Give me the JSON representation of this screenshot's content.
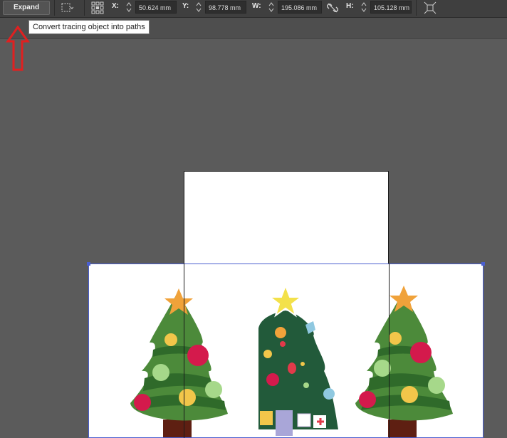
{
  "toolbar": {
    "expand_label": "Expand",
    "x_label": "X:",
    "x_value": "50.624 mm",
    "y_label": "Y:",
    "y_value": "98.778 mm",
    "w_label": "W:",
    "w_value": "195.086 mm",
    "h_label": "H:",
    "h_value": "105.128 mm"
  },
  "tooltip": {
    "text": "Convert tracing object into paths"
  },
  "icons": {
    "selection": "marquee-selection-icon",
    "transform": "reference-point-icon",
    "link": "constrain-proportions-link-icon",
    "transform_panel": "transform-panel-icon",
    "annotation": "red-up-arrow-annotation"
  },
  "colors": {
    "annotation_red": "#e02020",
    "selection_blue": "#4a5fd0"
  }
}
